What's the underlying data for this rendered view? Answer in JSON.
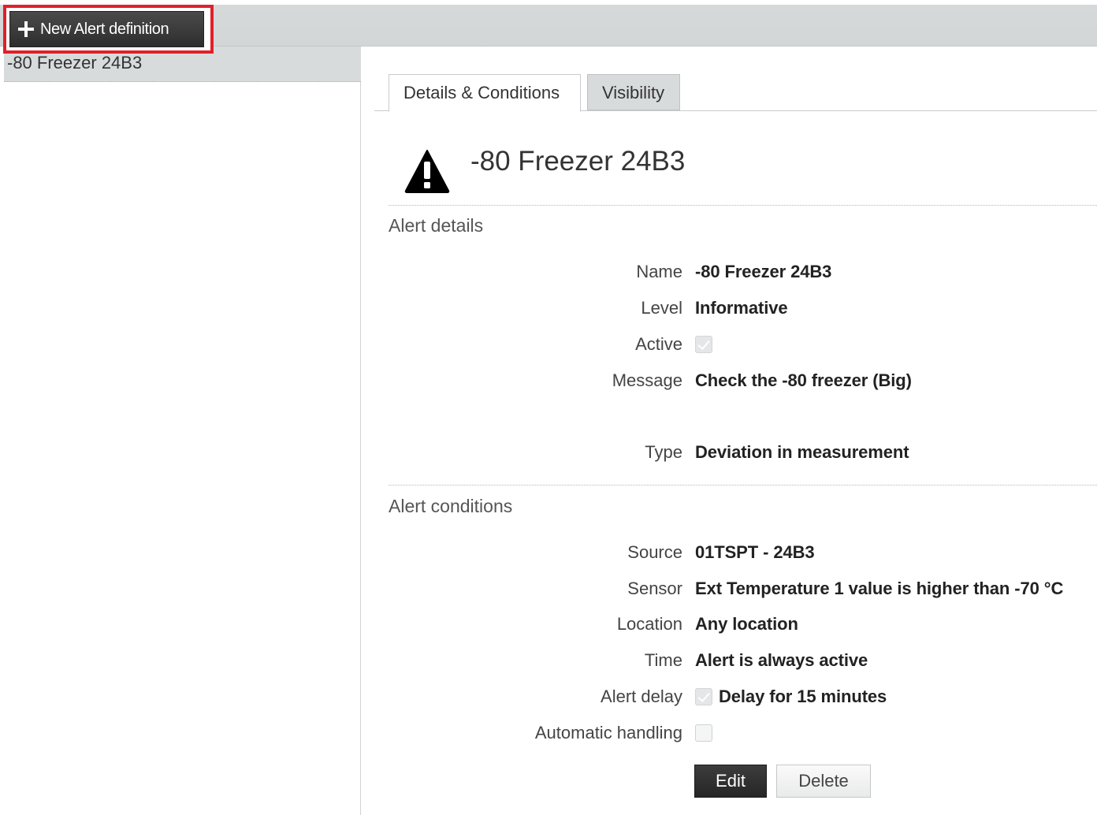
{
  "toolbar": {
    "new_alert_label": "New Alert definition",
    "new_alert_icon": "plus-icon"
  },
  "sidebar": {
    "items": [
      {
        "label": "-80 Freezer 24B3",
        "selected": true
      }
    ]
  },
  "tabs": [
    {
      "label": "Details & Conditions",
      "active": true
    },
    {
      "label": "Visibility",
      "active": false
    }
  ],
  "header": {
    "icon": "warning-icon",
    "title": "-80 Freezer 24B3"
  },
  "alert_details": {
    "section_title": "Alert details",
    "name_label": "Name",
    "name_value": "-80 Freezer 24B3",
    "level_label": "Level",
    "level_value": "Informative",
    "active_label": "Active",
    "active_checked": true,
    "message_label": "Message",
    "message_value": "Check the -80 freezer (Big)",
    "type_label": "Type",
    "type_value": "Deviation in measurement"
  },
  "alert_conditions": {
    "section_title": "Alert conditions",
    "source_label": "Source",
    "source_value": "01TSPT - 24B3",
    "sensor_label": "Sensor",
    "sensor_value": "Ext Temperature 1 value is higher than -70 °C",
    "location_label": "Location",
    "location_value": "Any location",
    "time_label": "Time",
    "time_value": "Alert is always active",
    "delay_label": "Alert delay",
    "delay_checked": true,
    "delay_value": "Delay for 15 minutes",
    "auto_label": "Automatic handling",
    "auto_checked": false
  },
  "actions": {
    "edit_label": "Edit",
    "delete_label": "Delete"
  },
  "colors": {
    "highlight_border": "#e0202a",
    "dark_button": "#2e2e2e",
    "panel_gray": "#d8dbdc"
  }
}
